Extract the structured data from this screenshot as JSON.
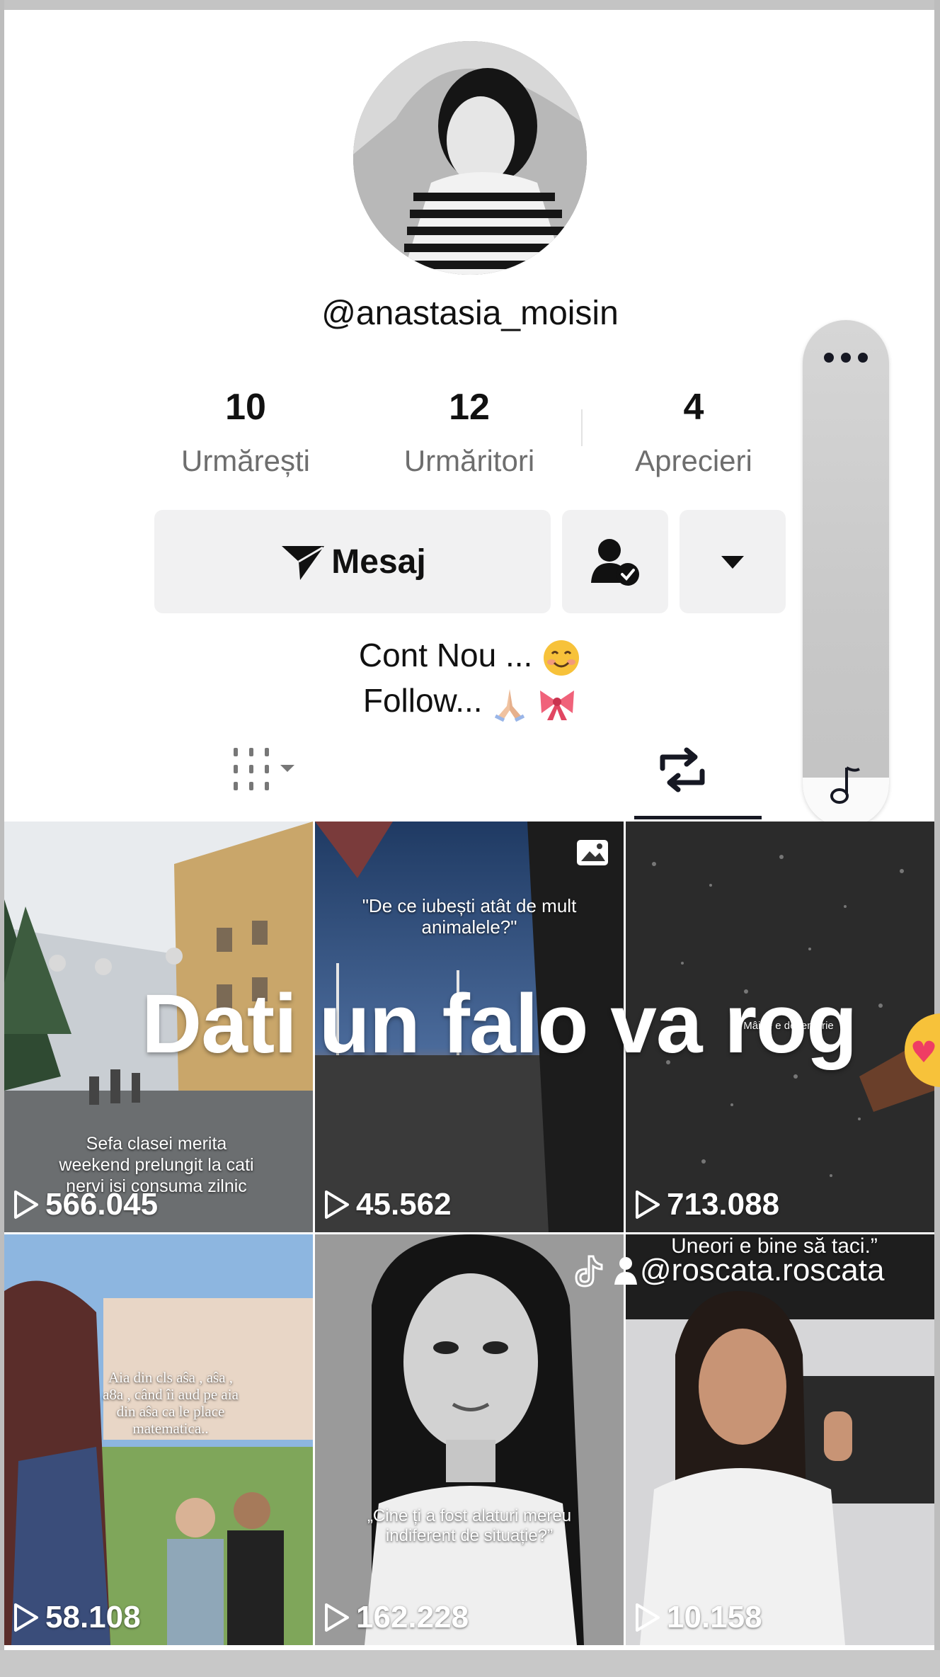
{
  "profile": {
    "username": "@anastasia_moisin",
    "stats": [
      {
        "value": "10",
        "label": "Urmărești"
      },
      {
        "value": "12",
        "label": "Urmăritori"
      },
      {
        "value": "4",
        "label": "Aprecieri"
      }
    ],
    "bio_line1": "Cont Nou ...",
    "bio_line2": "Follow..."
  },
  "actions": {
    "message_label": "Mesaj",
    "friend_icon": "person-check-icon",
    "more_icon": "caret-down-icon"
  },
  "tabs": {
    "grid_icon": "grid-sort-icon",
    "repost_icon": "repost-icon",
    "active": "reposts"
  },
  "side_panel": {
    "top_icon": "more-dots-icon",
    "bottom_icon": "music-note-icon"
  },
  "overlay": {
    "big_text": "Dati un falo va rog",
    "watermark": "@roscata.roscata"
  },
  "videos": [
    {
      "views": "566.045",
      "caption": "Sefa clasei merita weekend prelungit la cati nervi isi consuma zilnic"
    },
    {
      "views": "45.562",
      "caption": "\"De ce iubești atât de mult animalele?\"",
      "photo_icon": "photo-icon"
    },
    {
      "views": "713.088",
      "caption": "Mâine e decembrie"
    },
    {
      "views": "58.108",
      "caption": "Aia din cls aŝa , aŝa , a8a , când îi aud pe aia din aŝa ca le place matematica.."
    },
    {
      "views": "162.228",
      "caption": "„Cine ți a fost alaturi mereu indiferent de situație?”"
    },
    {
      "views": "10.158",
      "caption": "Uneori e bine să taci.”"
    }
  ],
  "colors": {
    "text": "#161823",
    "secondary": "#6e6e6e",
    "button_bg": "#f1f1f2"
  }
}
